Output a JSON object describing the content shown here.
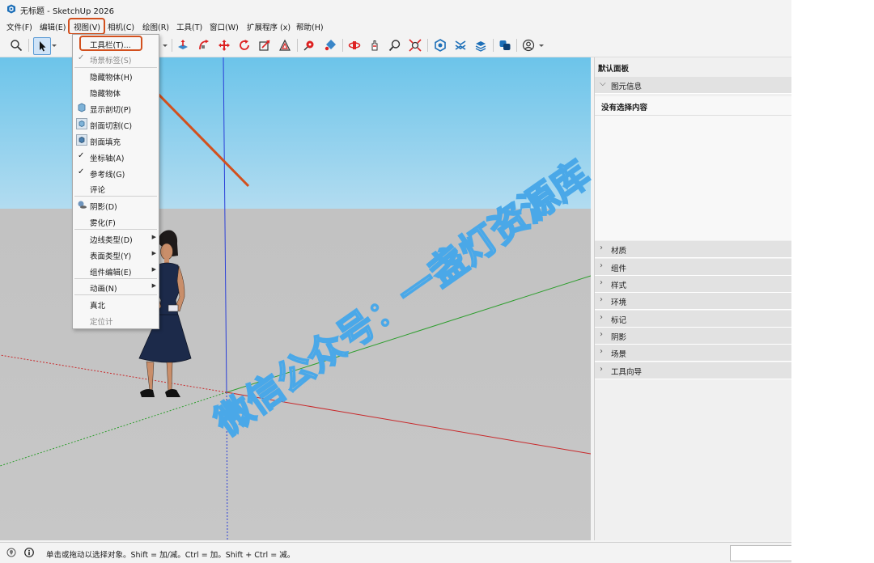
{
  "window": {
    "title": "无标题 - SketchUp 2026",
    "app_icon": "sketchup-logo-icon"
  },
  "menubar": {
    "items": [
      {
        "label": "文件(F)"
      },
      {
        "label": "编辑(E)"
      },
      {
        "label": "视图(V)"
      },
      {
        "label": "相机(C)"
      },
      {
        "label": "绘图(R)"
      },
      {
        "label": "工具(T)"
      },
      {
        "label": "窗口(W)"
      },
      {
        "label": "扩展程序 (x)"
      },
      {
        "label": "帮助(H)"
      }
    ],
    "open_menu": "视图(V)"
  },
  "view_menu": {
    "items": [
      {
        "label": "工具栏(T)...",
        "state": "highlighted"
      },
      {
        "label": "场景标签(S)",
        "state": "disabled",
        "check": "✓"
      },
      {
        "label": "隐藏物体(H)"
      },
      {
        "label": "隐藏物体"
      },
      {
        "label": "显示剖切(P)",
        "icon": "section-display-icon"
      },
      {
        "label": "剖面切割(C)",
        "icon": "section-cut-icon"
      },
      {
        "label": "剖面填充",
        "icon": "section-fill-icon"
      },
      {
        "label": "坐标轴(A)",
        "check": "✓"
      },
      {
        "label": "参考线(G)",
        "check": "✓"
      },
      {
        "label": "评论"
      },
      {
        "label": "阴影(D)",
        "icon": "shadow-icon"
      },
      {
        "label": "雾化(F)"
      },
      {
        "label": "边线类型(D)",
        "submenu": true
      },
      {
        "label": "表面类型(Y)",
        "submenu": true
      },
      {
        "label": "组件编辑(E)",
        "submenu": true
      },
      {
        "label": "动画(N)",
        "submenu": true
      },
      {
        "label": "真北"
      },
      {
        "label": "定位计",
        "state": "disabled"
      }
    ]
  },
  "toolbar": {
    "icons": [
      "zoom-icon",
      "select-arrow-icon",
      "dropdown-arrow-icon",
      "push-pull-icon",
      "follow-me-icon",
      "move-icon",
      "rotate-icon",
      "scale-icon",
      "offset-icon",
      "tape-measure-icon",
      "paint-bucket-icon",
      "orbit-icon",
      "pan-icon",
      "zoom-tool-icon",
      "zoom-extents-icon",
      "warehouse-icon",
      "extension-warehouse-icon",
      "layout-icon",
      "style-builder-icon",
      "account-icon"
    ]
  },
  "right_panel": {
    "title": "默认面板",
    "entity_info": {
      "label": "图元信息",
      "empty_text": "没有选择内容"
    },
    "sections": [
      {
        "label": "材质"
      },
      {
        "label": "组件"
      },
      {
        "label": "样式"
      },
      {
        "label": "环境"
      },
      {
        "label": "标记"
      },
      {
        "label": "阴影"
      },
      {
        "label": "场景"
      },
      {
        "label": "工具向导"
      }
    ]
  },
  "statusbar": {
    "text": "单击或拖动以选择对象。Shift = 加/减。Ctrl = 加。Shift + Ctrl = 减。"
  },
  "watermark": {
    "text": "微信公众号：一盏灯资源库"
  },
  "colors": {
    "sky_top": "#6cc4ea",
    "ground": "#c4c4c4",
    "annotation": "#d2501e",
    "axis_red": "#c8282a",
    "axis_green": "#2e9e2e",
    "axis_blue": "#2a3fd8",
    "watermark": "#4aa8e8"
  }
}
